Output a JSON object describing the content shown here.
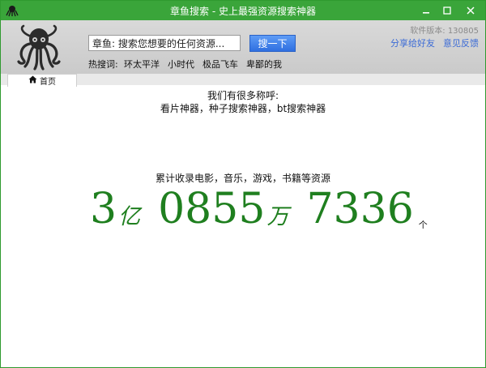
{
  "window": {
    "title": "章鱼搜索 - 史上最强资源搜索神器"
  },
  "header": {
    "search_value": "章鱼: 搜索您想要的任何资源...",
    "search_button": "搜一下",
    "hot_label": "热搜词:",
    "hot_words": [
      "环太平洋",
      "小时代",
      "极品飞车",
      "卑鄙的我"
    ],
    "version": "软件版本: 130805",
    "links": {
      "share": "分享给好友",
      "feedback": "意见反馈"
    }
  },
  "tabs": [
    {
      "label": "首页"
    }
  ],
  "content": {
    "intro1": "我们有很多称呼:",
    "intro2": "看片神器，种子搜索神器，bt搜索神器",
    "stats_caption": "累计收录电影，音乐，游戏，书籍等资源",
    "stats": {
      "yi": "3",
      "yi_unit": "亿",
      "wan": "0855",
      "wan_unit": "万",
      "ge": "7336",
      "ge_unit": "个"
    }
  },
  "colors": {
    "title_bar": "#3aa53a",
    "number": "#1f7f1f",
    "link": "#3b6bd6",
    "button": "#2f6fe0"
  },
  "icons": {
    "app": "octopus-icon",
    "home": "home-icon",
    "minimize": "minimize-icon",
    "maximize": "maximize-icon",
    "close": "close-icon"
  }
}
